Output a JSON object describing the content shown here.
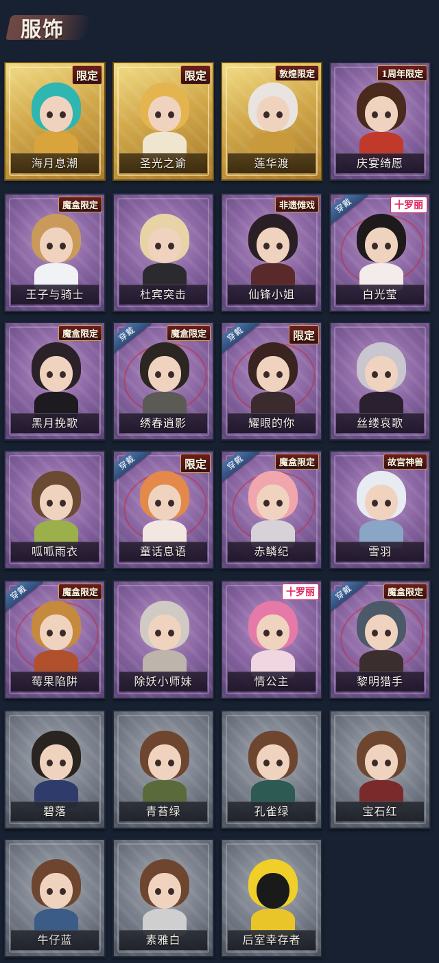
{
  "header": {
    "title": "服饰"
  },
  "badges": {
    "limited": "限定",
    "box_limited": "魔盒限定",
    "dunhuang": "敦煌限定",
    "anniversary": "1周年限定",
    "heritage": "非遗傩戏",
    "collab": "十罗丽",
    "palace": "故宫神兽",
    "wearing": "穿戴"
  },
  "costumes": [
    {
      "name": "海月息潮",
      "frame": "gold",
      "badge": "limited",
      "worn": false,
      "hair": "#2fb6b0",
      "outfit": "#d9a43b"
    },
    {
      "name": "圣光之谕",
      "frame": "gold",
      "badge": "limited",
      "worn": false,
      "hair": "#e4b44e",
      "outfit": "#f0e6d0"
    },
    {
      "name": "莲华渡",
      "frame": "gold",
      "badge": "dunhuang",
      "worn": false,
      "hair": "#e9e4df",
      "outfit": "#c99a3b"
    },
    {
      "name": "庆宴绮愿",
      "frame": "purple",
      "badge": "anniversary",
      "worn": false,
      "hair": "#4a2a1c",
      "outfit": "#c0392b"
    },
    {
      "name": "王子与骑士",
      "frame": "purple",
      "badge": "box_limited",
      "worn": false,
      "hair": "#c99a5a",
      "outfit": "#f0f2f6"
    },
    {
      "name": "杜宾突击",
      "frame": "purple",
      "badge": null,
      "worn": false,
      "hair": "#e8d3a7",
      "outfit": "#2b2b2f"
    },
    {
      "name": "仙锋小姐",
      "frame": "purple",
      "badge": "heritage",
      "worn": false,
      "hair": "#2a1f24",
      "outfit": "#5a2a2a"
    },
    {
      "name": "白光莹",
      "frame": "purple",
      "badge": "collab",
      "worn": true,
      "hair": "#1e1a1c",
      "outfit": "#f3ecea"
    },
    {
      "name": "黑月挽歌",
      "frame": "purple",
      "badge": "box_limited",
      "worn": false,
      "hair": "#2a2228",
      "outfit": "#1d1a20"
    },
    {
      "name": "绣春逍影",
      "frame": "purple",
      "badge": "box_limited",
      "worn": true,
      "hair": "#2b2622",
      "outfit": "#5b5a54"
    },
    {
      "name": "耀眼的你",
      "frame": "purple",
      "badge": "limited",
      "worn": true,
      "hair": "#3a2420",
      "outfit": "#3b2a2e"
    },
    {
      "name": "丝缕哀歌",
      "frame": "purple",
      "badge": null,
      "worn": false,
      "hair": "#c9c6cf",
      "outfit": "#2a2030"
    },
    {
      "name": "呱呱雨衣",
      "frame": "purple",
      "badge": null,
      "worn": false,
      "hair": "#6b4a33",
      "outfit": "#9bb04a"
    },
    {
      "name": "童话息语",
      "frame": "purple",
      "badge": "limited",
      "worn": true,
      "hair": "#e3894a",
      "outfit": "#f3e7e2"
    },
    {
      "name": "赤鳞纪",
      "frame": "purple",
      "badge": "box_limited",
      "worn": true,
      "hair": "#f1a6ad",
      "outfit": "#d6d2d8"
    },
    {
      "name": "雪羽",
      "frame": "purple",
      "badge": "palace",
      "worn": false,
      "hair": "#e7ecf2",
      "outfit": "#8aa6c6"
    },
    {
      "name": "莓果陷阱",
      "frame": "purple",
      "badge": "box_limited",
      "worn": true,
      "hair": "#c58a3e",
      "outfit": "#b0502c"
    },
    {
      "name": "除妖小师妹",
      "frame": "purple",
      "badge": null,
      "worn": false,
      "hair": "#cfcac4",
      "outfit": "#bdb5ab"
    },
    {
      "name": "情公主",
      "frame": "purple",
      "badge": "collab",
      "worn": false,
      "hair": "#e57aa8",
      "outfit": "#f0d6e0"
    },
    {
      "name": "黎明猎手",
      "frame": "purple",
      "badge": "box_limited",
      "worn": true,
      "hair": "#4b5968",
      "outfit": "#3a2f2e"
    },
    {
      "name": "碧落",
      "frame": "grey",
      "badge": null,
      "worn": false,
      "hair": "#2a2420",
      "outfit": "#2f3b6a"
    },
    {
      "name": "青苔绿",
      "frame": "grey",
      "badge": null,
      "worn": false,
      "hair": "#6e4630",
      "outfit": "#5b6a3a"
    },
    {
      "name": "孔雀绿",
      "frame": "grey",
      "badge": null,
      "worn": false,
      "hair": "#6e4630",
      "outfit": "#2d5a52"
    },
    {
      "name": "宝石红",
      "frame": "grey",
      "badge": null,
      "worn": false,
      "hair": "#6e4630",
      "outfit": "#7a2a2a"
    },
    {
      "name": "牛仔蓝",
      "frame": "grey",
      "badge": null,
      "worn": false,
      "hair": "#6e4630",
      "outfit": "#3b5c87"
    },
    {
      "name": "素雅白",
      "frame": "grey",
      "badge": null,
      "worn": false,
      "hair": "#6e4630",
      "outfit": "#cfcfcf"
    },
    {
      "name": "后室幸存者",
      "frame": "grey",
      "badge": null,
      "worn": false,
      "hair": "#f0cf2a",
      "outfit": "#e9c52a",
      "masked": true
    }
  ]
}
